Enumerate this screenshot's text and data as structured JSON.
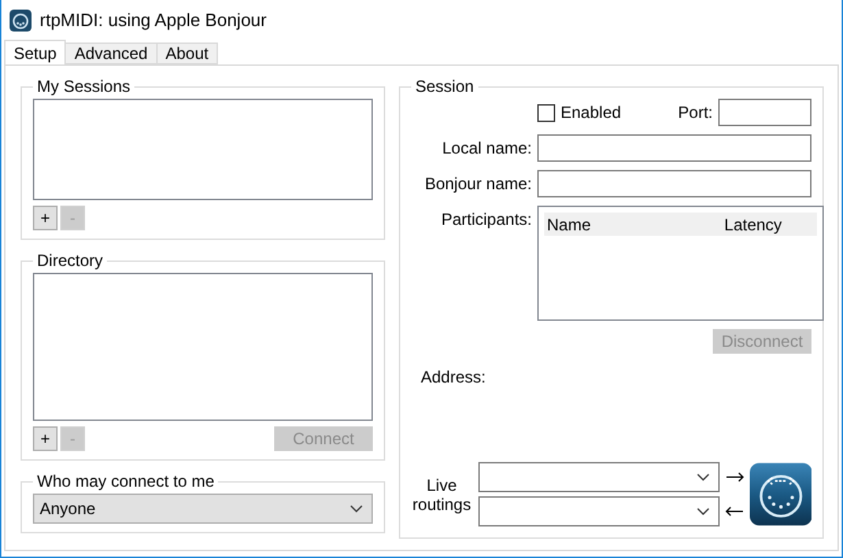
{
  "window": {
    "title": "rtpMIDI: using Apple Bonjour"
  },
  "tabs": [
    {
      "label": "Setup",
      "selected": true
    },
    {
      "label": "Advanced",
      "selected": false
    },
    {
      "label": "About",
      "selected": false
    }
  ],
  "my_sessions": {
    "title": "My Sessions",
    "buttons": [
      {
        "label": "+",
        "disabled": false
      },
      {
        "label": "-",
        "disabled": true
      }
    ]
  },
  "directory": {
    "title": "Directory",
    "buttons": [
      {
        "label": "+",
        "disabled": false
      },
      {
        "label": "-",
        "disabled": true
      }
    ],
    "connect": {
      "label": "Connect",
      "disabled": true
    }
  },
  "who_may_connect": {
    "title": "Who may connect to me",
    "value": "Anyone"
  },
  "session": {
    "title": "Session",
    "enabled": {
      "label": "Enabled",
      "checked": false
    },
    "port_label": "Port:",
    "local_name_label": "Local name:",
    "bonjour_name_label": "Bonjour name:",
    "participants_label": "Participants:",
    "participants_columns": [
      "Name",
      "Latency"
    ],
    "disconnect": {
      "label": "Disconnect",
      "disabled": true
    },
    "address_label": "Address:",
    "live_routings_label": "Live routings"
  }
}
